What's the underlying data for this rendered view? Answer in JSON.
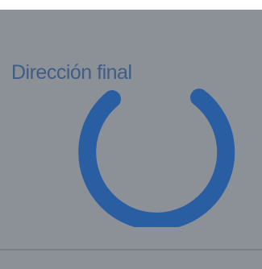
{
  "dialog": {
    "label": "Dirección final"
  },
  "spinner": {
    "icon": "loading-spinner-icon"
  },
  "colors": {
    "panel": "#8c9097",
    "text": "#3f5d85",
    "accent": "#2a5ea3"
  }
}
